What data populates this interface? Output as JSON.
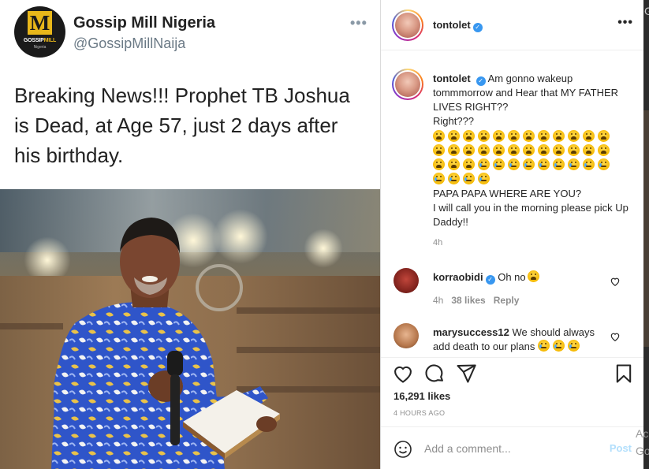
{
  "tweet": {
    "name": "Gossip Mill Nigeria",
    "handle": "@GossipMillNaija",
    "logo_letter": "M",
    "logo_brand_a": "GOSSIP",
    "logo_brand_b": "MILL",
    "logo_sub": "Nigeria",
    "more": "•••",
    "text": "Breaking News!!! Prophet TB Joshua is Dead, at Age 57, just 2 days after his birthday."
  },
  "post": {
    "username": "tontolet",
    "verified_mark": "✓",
    "more": "•••",
    "caption_user": "tontolet",
    "caption_line1": "Am gonno wakeup tommmorrow and Hear that MY FATHER LIVES RIGHT??",
    "caption_line2": "Right???",
    "emoji_scared_count": 27,
    "emoji_cry_count": 13,
    "caption_line3": "PAPA PAPA WHERE ARE YOU?",
    "caption_line4": "I will call you in the morning please pick Up Daddy!!",
    "caption_time": "4h",
    "comments": [
      {
        "user": "korraobidi",
        "text": "Oh no",
        "time": "4h",
        "likes": "38 likes",
        "reply": "Reply"
      },
      {
        "user": "marysuccess12",
        "text": "We should always add death to our plans"
      }
    ],
    "likes": "16,291 likes",
    "ago": "4 HOURS AGO",
    "comment_placeholder": "Add a comment...",
    "post_label": "Post"
  },
  "os": {
    "activate_a": "Ac",
    "activate_b": "Go",
    "scroll_g": "G"
  },
  "colors": {
    "ig_blue": "#3897f0",
    "post_disabled": "#b2dffc",
    "logo_gold": "#e8b71a"
  }
}
